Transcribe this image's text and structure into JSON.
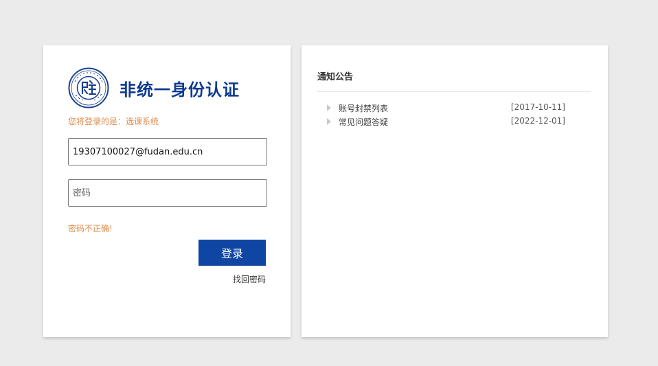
{
  "login": {
    "title": "非统一身份认证",
    "target_system": "您将登录的是：选课系统",
    "username": {
      "value": "19307100027@fudan.edu.cn",
      "placeholder": ""
    },
    "password": {
      "value": "",
      "placeholder": "密码"
    },
    "error_message": "密码不正确!",
    "login_button_label": "登录",
    "forgot_password_label": "找回密码"
  },
  "notices": {
    "title": "通知公告",
    "items": [
      {
        "title": "账号封禁列表",
        "date": "[2017-10-11]"
      },
      {
        "title": "常见问题答疑",
        "date": "[2022-12-01]"
      }
    ]
  },
  "colors": {
    "brand_blue": "#0b3a8f",
    "button_blue": "#0f45a3",
    "warning_orange": "#e28b4a",
    "background": "#ebebeb"
  }
}
